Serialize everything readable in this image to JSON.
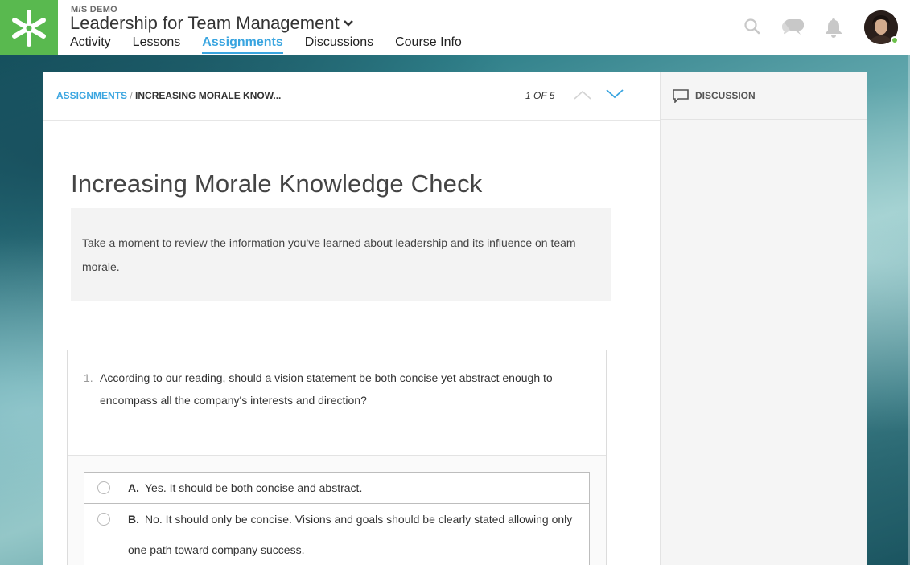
{
  "header": {
    "org": "M/S DEMO",
    "course_title": "Leadership for Team Management",
    "nav": [
      "Activity",
      "Lessons",
      "Assignments",
      "Discussions",
      "Course Info"
    ],
    "active_nav": "Assignments",
    "icons": [
      "search-icon",
      "chat-icon",
      "bell-icon"
    ],
    "brand_color": "#59b94f",
    "accent_color": "#3aa5e0"
  },
  "breadcrumb": {
    "root": "ASSIGNMENTS",
    "separator": "/",
    "current": "INCREASING MORALE KNOW..."
  },
  "pager": "1 OF 5",
  "assignment": {
    "title": "Increasing Morale Knowledge Check",
    "intro": "Take a moment to review the information you've learned about leadership and its influence on team morale."
  },
  "question": {
    "number": "1.",
    "text": "According to our reading, should a vision statement be both concise yet abstract enough to encompass all the company's interests and direction?",
    "options": [
      {
        "letter": "A.",
        "text": "Yes. It should be both concise and abstract."
      },
      {
        "letter": "B.",
        "text": "No. It should only be concise. Visions and goals should be clearly stated allowing only one path toward company success."
      }
    ]
  },
  "sidebar": {
    "discussion_label": "DISCUSSION"
  }
}
